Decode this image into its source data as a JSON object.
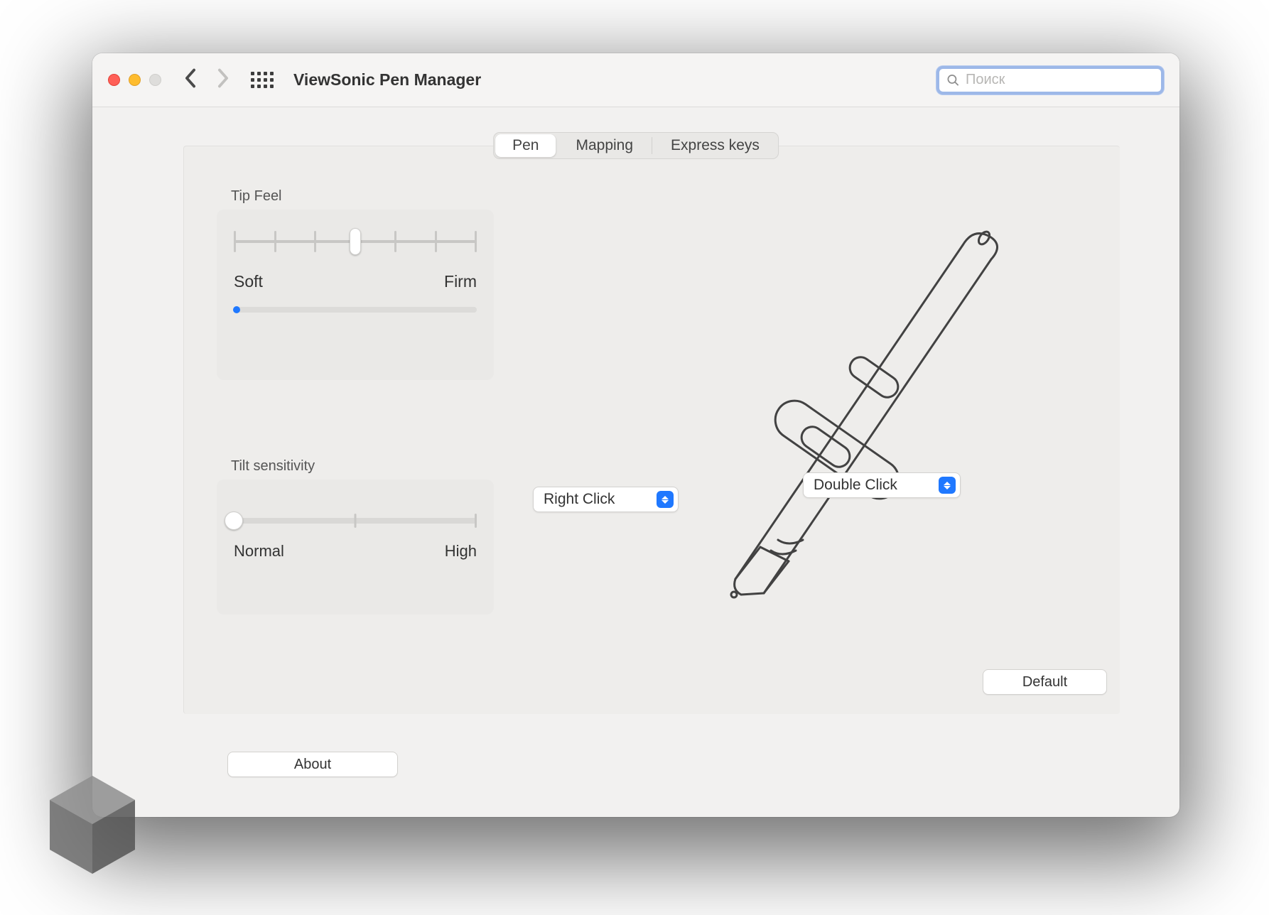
{
  "toolbar": {
    "window_title": "ViewSonic Pen Manager",
    "search_placeholder": "Поиск"
  },
  "tabs": {
    "pen": "Pen",
    "mapping": "Mapping",
    "express": "Express keys",
    "active": "pen"
  },
  "tip_feel": {
    "label": "Tip Feel",
    "soft": "Soft",
    "firm": "Firm",
    "slider_ticks": 7,
    "slider_position_index": 3,
    "pressure_value": 0
  },
  "tilt": {
    "label": "Tilt sensitivity",
    "normal": "Normal",
    "high": "High",
    "slider_value": 0
  },
  "pen_buttons": {
    "lower": "Right Click",
    "upper": "Double Click"
  },
  "buttons": {
    "default": "Default",
    "about": "About"
  }
}
